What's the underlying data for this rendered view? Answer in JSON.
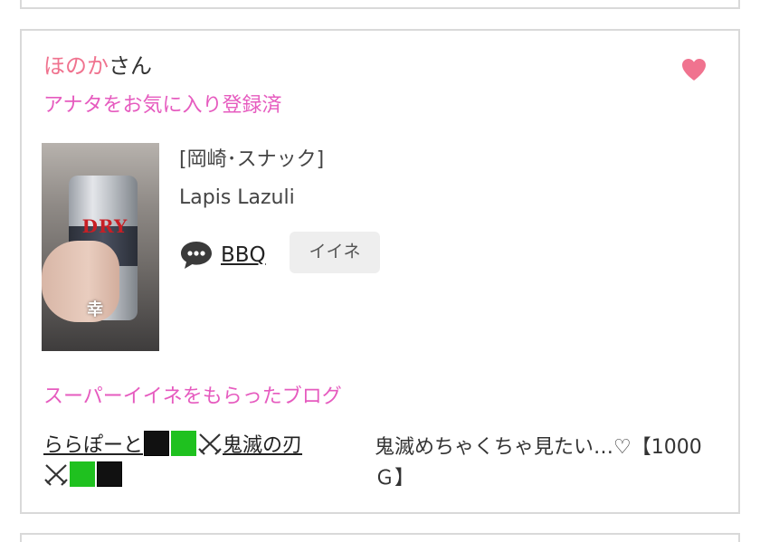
{
  "post": {
    "user_name": "ほのか",
    "user_suffix": "さん",
    "favorite_status": "アナタをお気に入り登録済",
    "thumbnail_caption": "幸",
    "thumbnail_can_text": "DRY",
    "shop_area": "[岡崎･スナック]",
    "shop_name": "Lapis Lazuli",
    "comment_label": "BBQ",
    "iine_label": "イイネ"
  },
  "blog": {
    "heading": "スーパーイイネをもらったブログ",
    "title_part1": "ららぽーと",
    "title_part2": "鬼滅の刃",
    "description": "鬼滅めちゃくちゃ見たい…♡【1000Ｇ】"
  },
  "colors": {
    "accent_pink": "#f0738f",
    "heading_magenta": "#e65bbf",
    "border": "#d9d9d9",
    "button_bg": "#eeeeee"
  },
  "icons": [
    "heart-icon",
    "comment-bubble-icon",
    "crossed-swords-icon"
  ]
}
